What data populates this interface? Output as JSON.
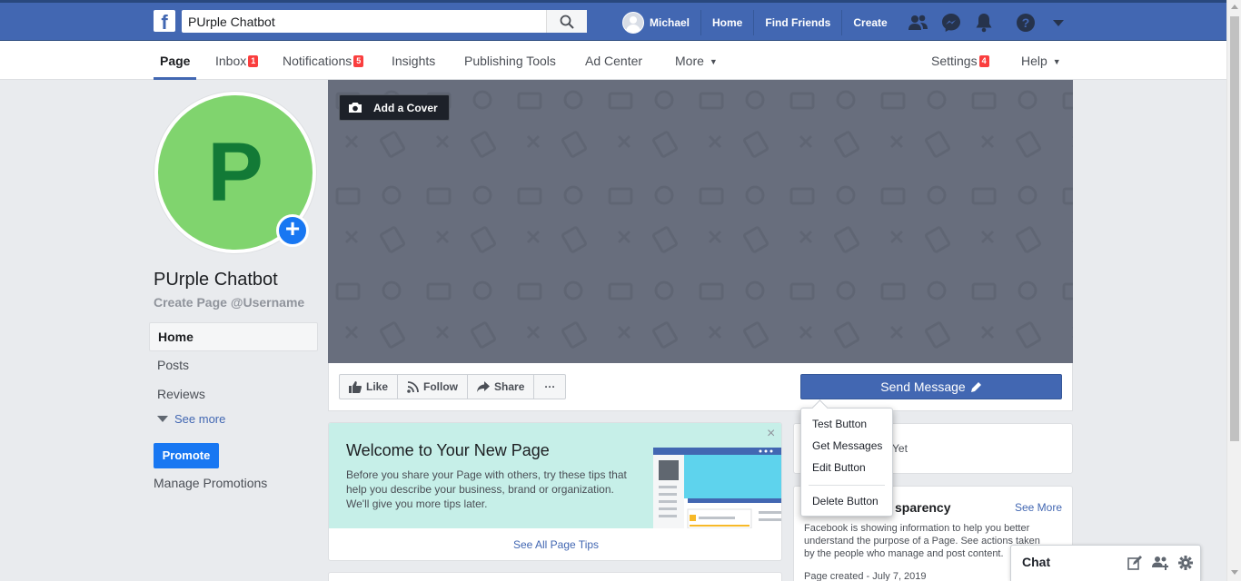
{
  "topbar": {
    "logo": "f",
    "search_value": "PUrple Chatbot",
    "user_name": "Michael",
    "links": [
      "Home",
      "Find Friends",
      "Create"
    ]
  },
  "pagenav": {
    "page": "Page",
    "inbox": "Inbox",
    "inbox_badge": "1",
    "notifications": "Notifications",
    "notifications_badge": "5",
    "insights": "Insights",
    "publishing_tools": "Publishing Tools",
    "ad_center": "Ad Center",
    "more": "More",
    "settings": "Settings",
    "settings_badge": "4",
    "help": "Help"
  },
  "profile": {
    "initial": "P",
    "add_symbol": "+",
    "name": "PUrple Chatbot",
    "username_link": "Create Page @Username"
  },
  "left_menu": {
    "items": [
      "Home",
      "Posts",
      "Reviews"
    ],
    "see_more": "See more",
    "promote": "Promote",
    "manage_promotions": "Manage Promotions"
  },
  "cover": {
    "add_cover": "Add a Cover"
  },
  "actions": {
    "like": "Like",
    "follow": "Follow",
    "share": "Share",
    "more": "···",
    "send_message": "Send Message"
  },
  "dropdown": {
    "items": [
      "Test Button",
      "Get Messages",
      "Edit Button",
      "Delete Button"
    ]
  },
  "welcome": {
    "title": "Welcome to Your New Page",
    "text": "Before you share your Page with others, try these tips that help you describe your business, brand or organization. We'll give you more tips later.",
    "close": "×",
    "see_all": "See All Page Tips"
  },
  "right": {
    "card1_text": "Yet",
    "card2_title": "sparency",
    "card2_more": "See More",
    "card2_text": "Facebook is showing information to help you better understand the purpose of a Page. See actions taken by the people who manage and post content.",
    "card2_created": "Page created - July 7, 2019"
  },
  "chat": {
    "label": "Chat"
  },
  "colors": {
    "brand_blue": "#4267b2",
    "accent_blue": "#1877f2",
    "badge_red": "#fa3e3e",
    "profile_green": "#80d46e",
    "cover_gray": "#686e7d",
    "welcome_teal": "#c6efe8"
  },
  "icons": [
    "search-icon",
    "friends-icon",
    "messenger-icon",
    "bell-icon",
    "help-icon",
    "caret-down-icon",
    "camera-icon",
    "like-icon",
    "follow-icon",
    "share-icon",
    "pencil-icon",
    "compose-icon",
    "group-icon",
    "gear-icon"
  ]
}
